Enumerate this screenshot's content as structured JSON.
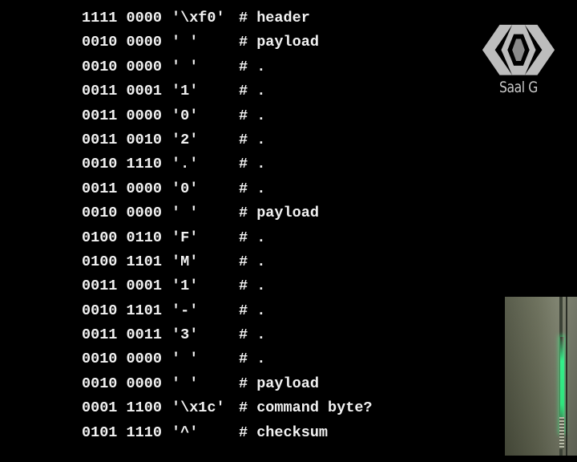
{
  "lines": [
    {
      "bits": "1111 0000",
      "char": "'\\xf0'",
      "comment": "# header"
    },
    {
      "bits": "0010 0000",
      "char": "' '",
      "comment": "# payload"
    },
    {
      "bits": "0010 0000",
      "char": "' '",
      "comment": "# ."
    },
    {
      "bits": "0011 0001",
      "char": "'1'",
      "comment": "# ."
    },
    {
      "bits": "0011 0000",
      "char": "'0'",
      "comment": "# ."
    },
    {
      "bits": "0011 0010",
      "char": "'2'",
      "comment": "# ."
    },
    {
      "bits": "0010 1110",
      "char": "'.'",
      "comment": "# ."
    },
    {
      "bits": "0011 0000",
      "char": "'0'",
      "comment": "# ."
    },
    {
      "bits": "0010 0000",
      "char": "' '",
      "comment": "# payload"
    },
    {
      "bits": "0100 0110",
      "char": "'F'",
      "comment": "# ."
    },
    {
      "bits": "0100 1101",
      "char": "'M'",
      "comment": "# ."
    },
    {
      "bits": "0011 0001",
      "char": "'1'",
      "comment": "# ."
    },
    {
      "bits": "0010 1101",
      "char": "'-'",
      "comment": "# ."
    },
    {
      "bits": "0011 0011",
      "char": "'3'",
      "comment": "# ."
    },
    {
      "bits": "0010 0000",
      "char": "' '",
      "comment": "# ."
    },
    {
      "bits": "0010 0000",
      "char": "' '",
      "comment": "# payload"
    },
    {
      "bits": "0001 1100",
      "char": "'\\x1c'",
      "comment": "# command byte?"
    },
    {
      "bits": "0101 1110",
      "char": "'^'",
      "comment": "# checksum"
    }
  ],
  "logo": {
    "label": "Saal G",
    "icon": "ccc-logo-icon"
  },
  "inset": {
    "icon": "camera-inset-icon"
  },
  "colors": {
    "background": "#000000",
    "text": "#f2f2f2",
    "logo": "#c9c9c9",
    "glow": "#33f08a"
  }
}
